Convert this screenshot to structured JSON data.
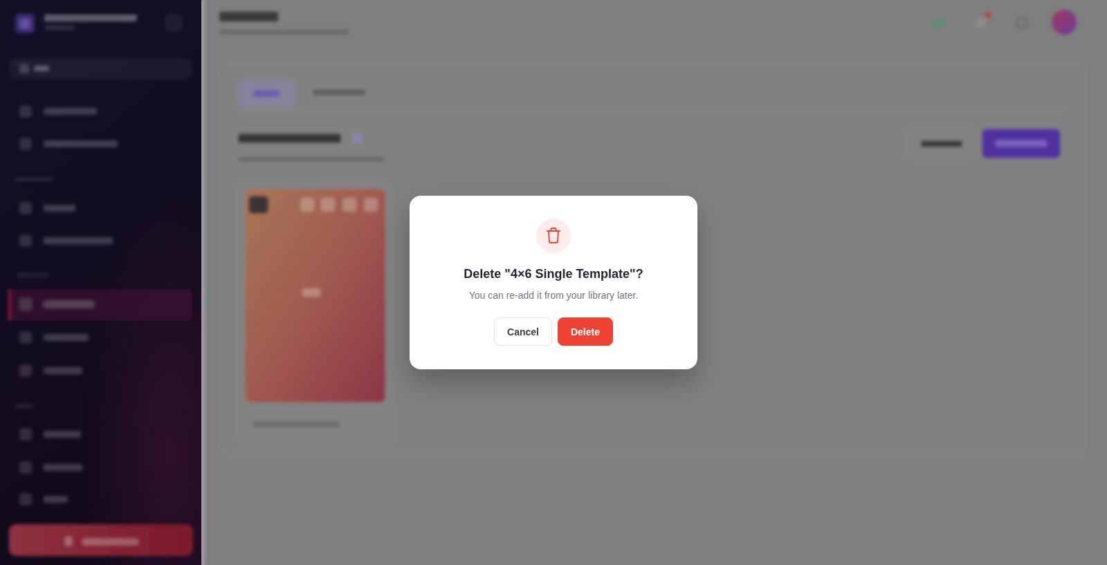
{
  "dialog": {
    "title": "Delete \"4×6 Single Template\"?",
    "message": "You can re-add it from your library later.",
    "buttons": [
      {
        "label": "Cancel",
        "kind": "secondary"
      },
      {
        "label": "Delete",
        "kind": "danger"
      }
    ]
  }
}
